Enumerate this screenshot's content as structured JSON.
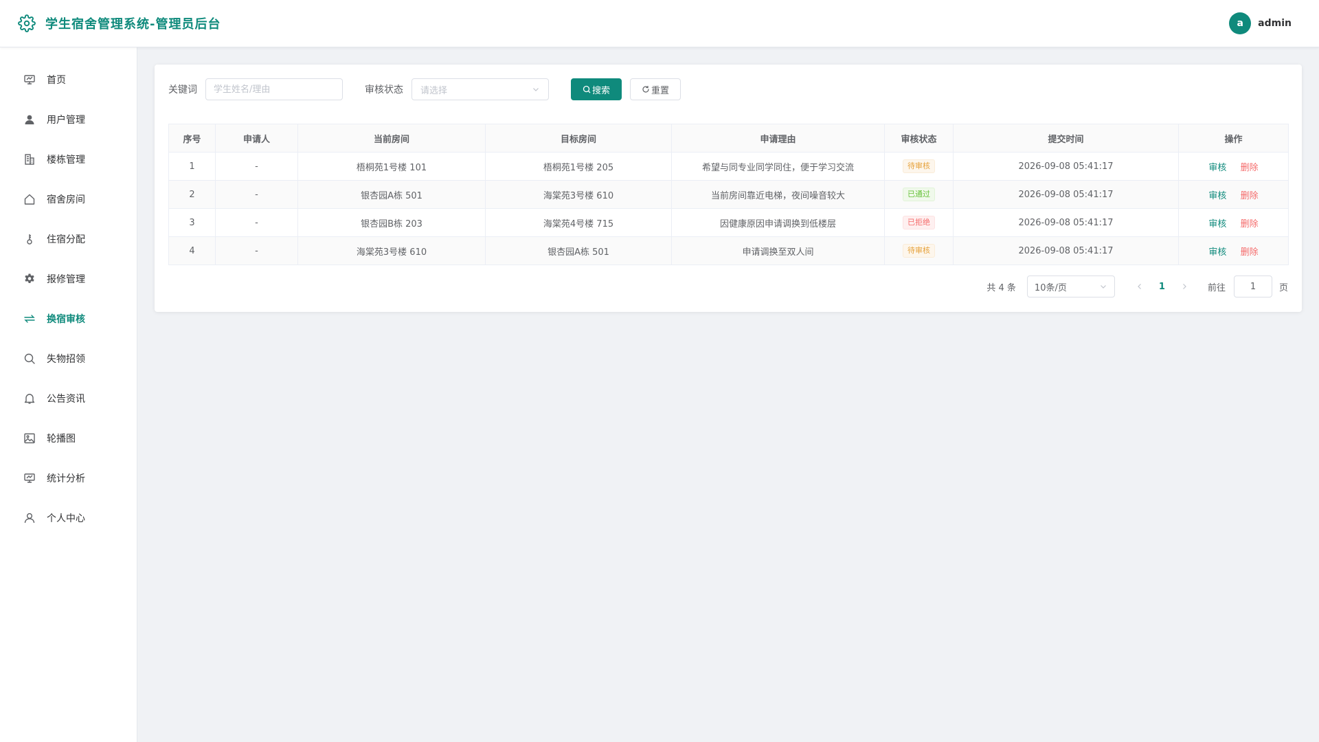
{
  "header": {
    "title": "学生宿舍管理系统-管理员后台",
    "avatar_letter": "a",
    "username": "admin"
  },
  "colors": {
    "brand": "#0f8a7c",
    "danger": "#f56c6c",
    "warning": "#e6a23c",
    "success": "#67c23a"
  },
  "sidebar": {
    "items": [
      {
        "label": "首页",
        "icon": "dashboard-icon"
      },
      {
        "label": "用户管理",
        "icon": "user-icon"
      },
      {
        "label": "楼栋管理",
        "icon": "building-icon"
      },
      {
        "label": "宿舍房间",
        "icon": "house-icon"
      },
      {
        "label": "住宿分配",
        "icon": "key-icon"
      },
      {
        "label": "报修管理",
        "icon": "gear-icon"
      },
      {
        "label": "换宿审核",
        "icon": "swap-icon",
        "active": true
      },
      {
        "label": "失物招领",
        "icon": "search-icon"
      },
      {
        "label": "公告资讯",
        "icon": "bell-icon"
      },
      {
        "label": "轮播图",
        "icon": "picture-icon"
      },
      {
        "label": "统计分析",
        "icon": "chart-icon"
      },
      {
        "label": "个人中心",
        "icon": "person-icon"
      }
    ]
  },
  "filters": {
    "keyword_label": "关键词",
    "keyword_placeholder": "学生姓名/理由",
    "keyword_value": "",
    "status_label": "审核状态",
    "status_placeholder": "请选择",
    "search_label": "搜索",
    "reset_label": "重置"
  },
  "table": {
    "columns": [
      "序号",
      "申请人",
      "当前房间",
      "目标房间",
      "申请理由",
      "审核状态",
      "提交时间",
      "操作"
    ],
    "rows": [
      {
        "index": "1",
        "applicant": "-",
        "current_room": "梧桐苑1号楼 101",
        "target_room": "梧桐苑1号楼 205",
        "reason": "希望与同专业同学同住，便于学习交流",
        "status": "待审核",
        "status_type": "warning",
        "submitted": "2026-09-08 05:41:17"
      },
      {
        "index": "2",
        "applicant": "-",
        "current_room": "银杏园A栋 501",
        "target_room": "海棠苑3号楼 610",
        "reason": "当前房间靠近电梯，夜间噪音较大",
        "status": "已通过",
        "status_type": "success",
        "submitted": "2026-09-08 05:41:17"
      },
      {
        "index": "3",
        "applicant": "-",
        "current_room": "银杏园B栋 203",
        "target_room": "海棠苑4号楼 715",
        "reason": "因健康原因申请调换到低楼层",
        "status": "已拒绝",
        "status_type": "danger",
        "submitted": "2026-09-08 05:41:17"
      },
      {
        "index": "4",
        "applicant": "-",
        "current_room": "海棠苑3号楼 610",
        "target_room": "银杏园A栋 501",
        "reason": "申请调换至双人间",
        "status": "待审核",
        "status_type": "warning",
        "submitted": "2026-09-08 05:41:17"
      }
    ],
    "actions": {
      "review": "审核",
      "delete": "删除"
    }
  },
  "pagination": {
    "total_text": "共 4 条",
    "page_size": "10条/页",
    "current_page": "1",
    "goto_label": "前往",
    "goto_value": "1",
    "page_suffix": "页"
  }
}
